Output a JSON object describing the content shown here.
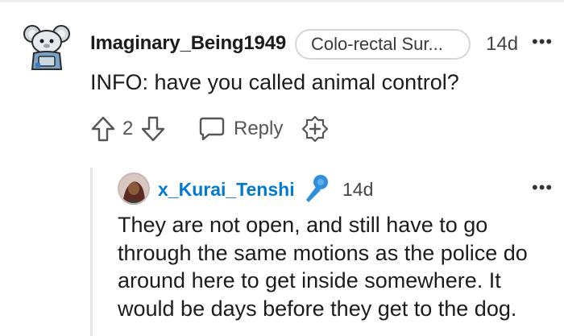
{
  "parent_comment": {
    "username": "Imaginary_Being1949",
    "flair": "Colo-rectal Sur...",
    "timestamp": "14d",
    "more_label": "•••",
    "body": "INFO: have you called animal control?",
    "score": "2",
    "reply_label": "Reply",
    "avatar_icon": "snoo-avatar-icon",
    "upvote_icon": "upvote-arrow-icon",
    "downvote_icon": "downvote-arrow-icon",
    "reply_icon": "speech-bubble-icon",
    "award_icon": "award-plus-icon"
  },
  "reply_comment": {
    "username": "x_Kurai_Tenshi",
    "timestamp": "14d",
    "more_label": "•••",
    "body": "They are not open, and still have to go through the same motions as the police do around here to get inside somewhere. It would be days before they get to the dog.",
    "avatar_icon": "user-avatar-icon",
    "badge_icon": "microphone-icon"
  },
  "colors": {
    "username_link": "#0079d3",
    "text": "#1c1c1c",
    "muted": "#555555",
    "thread_line": "#e4e6e8"
  }
}
